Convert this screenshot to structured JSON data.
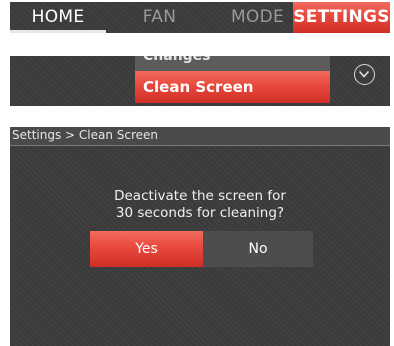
{
  "nav": {
    "tabs": [
      {
        "label": "HOME",
        "active": true
      },
      {
        "label": "FAN",
        "active": false
      },
      {
        "label": "MODE",
        "active": false
      },
      {
        "label": "SETTINGS",
        "active": false,
        "highlight": true
      }
    ]
  },
  "settings_list": {
    "items": [
      {
        "label": "Changes"
      },
      {
        "label": "Clean Screen",
        "selected": true
      }
    ],
    "scroll_icon": "chevron-down-circle-icon"
  },
  "dialog": {
    "breadcrumb": "Settings > Clean Screen",
    "question_line1": "Deactivate the screen for",
    "question_line2": "30 seconds for cleaning?",
    "yes_label": "Yes",
    "no_label": "No"
  },
  "colors": {
    "accent_red": "#e8493d",
    "background": "#3b3b3b",
    "inactive_text": "#9a9a9a"
  }
}
